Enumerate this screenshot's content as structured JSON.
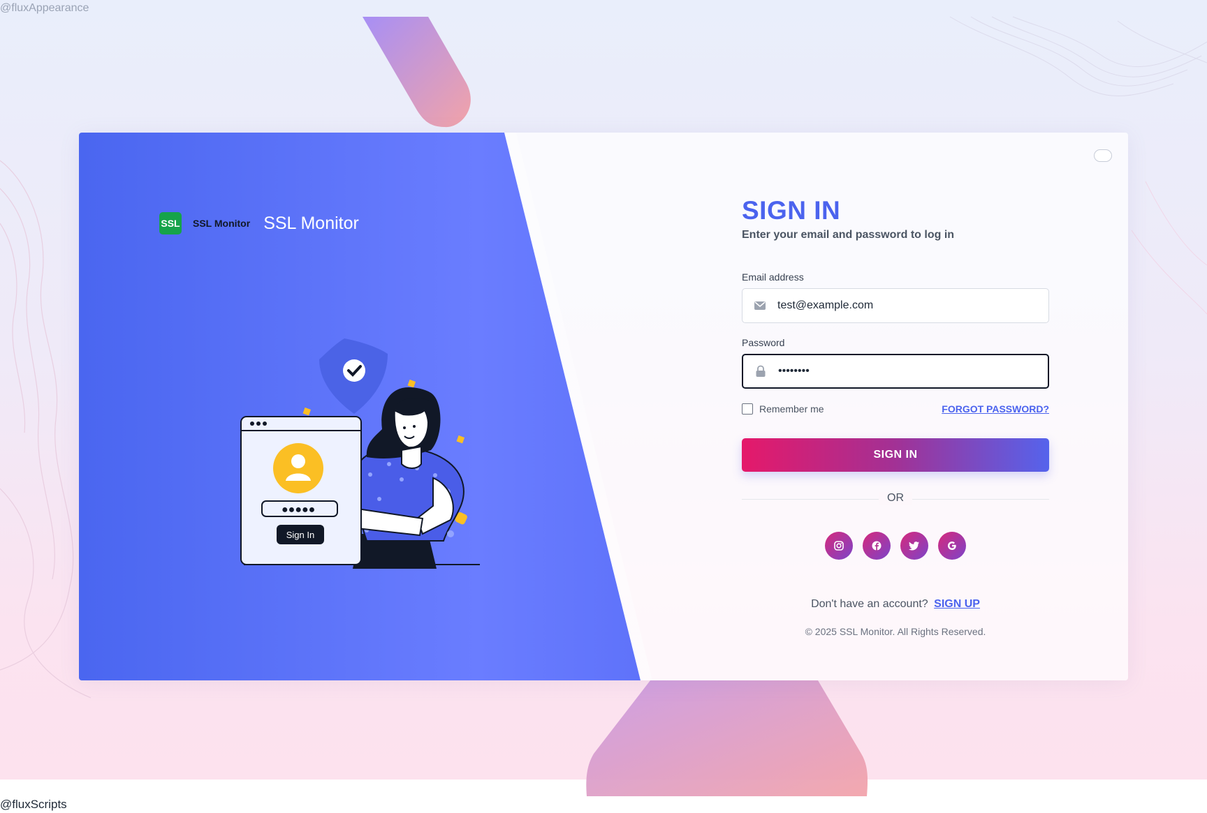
{
  "watermarks": {
    "top": "@fluxAppearance",
    "bottom": "@fluxScripts"
  },
  "brand": {
    "logo_text": "SSL",
    "small_name": "SSL Monitor",
    "large_name": "SSL Monitor"
  },
  "illustration": {
    "button_label": "Sign In",
    "password_mask": "●●●●●"
  },
  "form": {
    "title": "SIGN IN",
    "subtitle": "Enter your email and password to log in",
    "email_label": "Email address",
    "email_value": "test@example.com",
    "password_label": "Password",
    "password_value": "password",
    "remember_label": "Remember me",
    "remember_checked": false,
    "forgot_label": "FORGOT PASSWORD?",
    "submit_label": "SIGN IN",
    "divider": "OR",
    "social_icons": [
      "instagram-icon",
      "facebook-icon",
      "twitter-icon",
      "google-icon"
    ],
    "signup_prompt": "Don't have an account?",
    "signup_link": "SIGN UP",
    "copyright": "© 2025 SSL Monitor. All Rights Reserved."
  },
  "colors": {
    "accent": "#4b63ee",
    "brand_green": "#16a34a",
    "button_start": "#e5196a",
    "button_end": "#5563ec"
  }
}
